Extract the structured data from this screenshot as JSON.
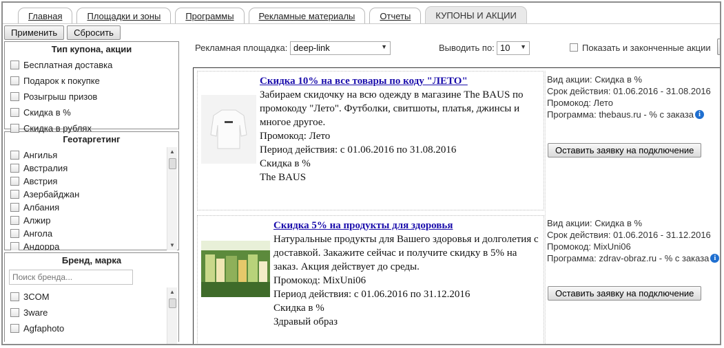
{
  "tabs": [
    {
      "label": "Главная",
      "active": false
    },
    {
      "label": "Площадки и зоны",
      "active": false
    },
    {
      "label": "Программы",
      "active": false
    },
    {
      "label": "Рекламные материалы",
      "active": false
    },
    {
      "label": "Отчеты",
      "active": false
    },
    {
      "label": "КУПОНЫ И АКЦИИ",
      "active": true
    }
  ],
  "sidebar": {
    "apply_label": "Применить",
    "reset_label": "Сбросить",
    "coupon_type": {
      "title": "Тип купона, акции",
      "items": [
        "Бесплатная доставка",
        "Подарок к покупке",
        "Розыгрыш призов",
        "Скидка в %",
        "Скидка в рублях"
      ]
    },
    "geo": {
      "title": "Геотаргетинг",
      "items": [
        "Ангилья",
        "Австралия",
        "Австрия",
        "Азербайджан",
        "Албания",
        "Алжир",
        "Ангола",
        "Андорра"
      ]
    },
    "brand": {
      "title": "Бренд, марка",
      "search_placeholder": "Поиск бренда...",
      "items": [
        "3COM",
        "3ware",
        "Agfaphoto"
      ]
    }
  },
  "filter": {
    "platform_label": "Рекламная площадка:",
    "platform_value": "deep-link",
    "per_page_label": "Выводить по:",
    "per_page_value": "10",
    "show_finished_label": "Показать и законченные акции"
  },
  "coupons": [
    {
      "title": "Скидка 10% на все товары по коду \"ЛЕТО\"",
      "description": "Забираем скидочку на всю одежду в магазине The BAUS по промокоду \"Лето\". Футболки, свитшоты, платья, джинсы и многое другое.",
      "promo": "Промокод: Лето",
      "period": "Период действия: с 01.06.2016 по 31.08.2016",
      "kind": "Скидка в %",
      "shop": "The BAUS",
      "info_type": "Вид акции: Скидка в %",
      "info_term": "Срок действия: 01.06.2016 - 31.08.2016",
      "info_promo": "Промокод: Лето",
      "info_program": "Программа: thebaus.ru - % с заказа",
      "button": "Оставить заявку на подключение"
    },
    {
      "title": "Скидка 5% на продукты для здоровья",
      "description": "Натуральные продукты для Вашего здоровья и долголетия с доставкой. Закажите сейчас и получите скидку в 5% на заказ. Акция действует до среды.",
      "promo": "Промокод: MixUni06",
      "period": "Период действия: с 01.06.2016 по 31.12.2016",
      "kind": "Скидка в %",
      "shop": "Здравый образ",
      "info_type": "Вид акции: Скидка в %",
      "info_term": "Срок действия: 01.06.2016 - 31.12.2016",
      "info_promo": "Промокод: MixUni06",
      "info_program": "Программа: zdrav-obraz.ru - % с заказа",
      "button": "Оставить заявку на подключение"
    }
  ],
  "icons": {
    "info": "info-icon",
    "dropdown": "chevron-down-icon"
  },
  "colors": {
    "link": "#1a0dab",
    "info_icon": "#1f6fd0"
  }
}
